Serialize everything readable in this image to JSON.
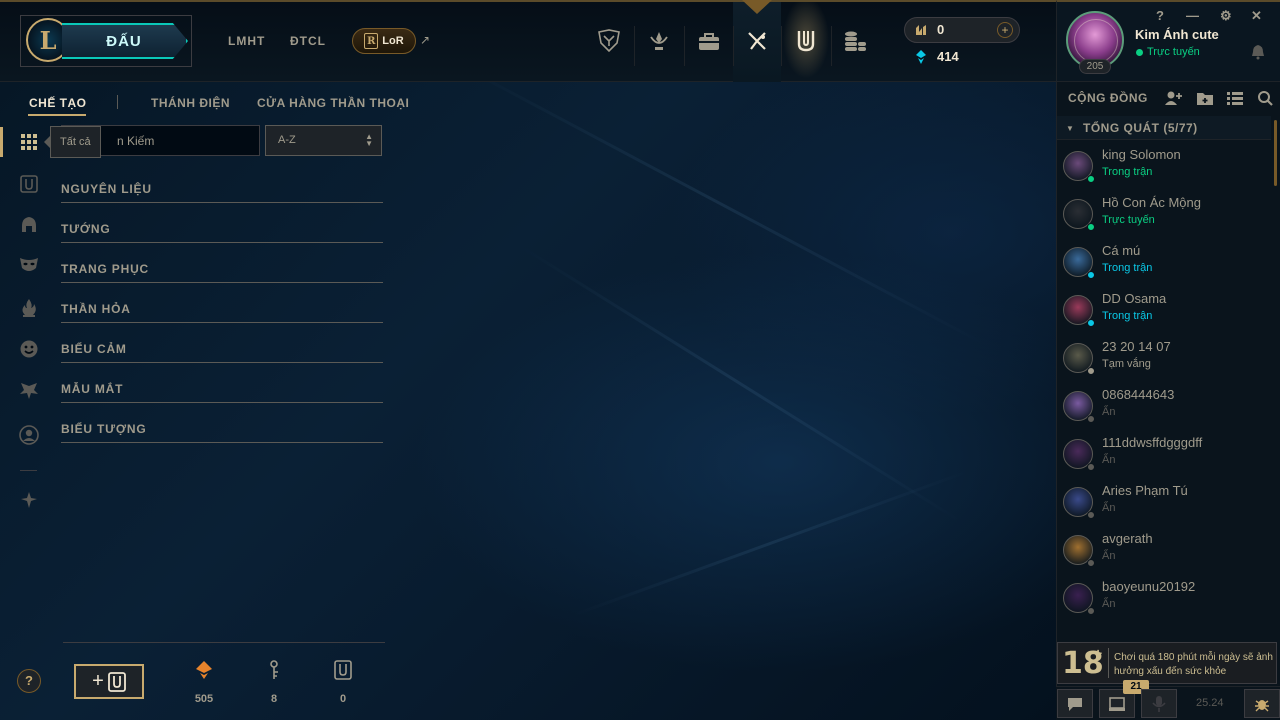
{
  "topbar": {
    "logo_letter": "L",
    "play_label": "ĐẤU",
    "nav_links": [
      "LMHT",
      "ĐTCL"
    ],
    "lor_label": "LoR",
    "lor_badge_letter": "R",
    "external_arrow": "↗",
    "tools": [
      "esports-crest-icon",
      "rank-crest-icon",
      "inventory-bag-icon",
      "loot-hextech-icon",
      "collection-icon",
      "store-coins-icon"
    ],
    "rp_value": "0",
    "be_value": "414",
    "plus_label": "+"
  },
  "profile": {
    "name": "Kim Ánh cute",
    "status": "Trực tuyến",
    "level": "205",
    "controls": [
      "?",
      "—",
      "⚙",
      "✕"
    ]
  },
  "subnav": {
    "tabs": [
      "CHẾ TẠO",
      "THÁNH ĐIỆN",
      "CỬA HÀNG THẦN THOẠI"
    ]
  },
  "loot": {
    "tooltip": "Tất cả",
    "search_placeholder": "Tìm Kiếm",
    "search_visible_text": "n Kiếm",
    "sort_value": "A-Z",
    "categories": [
      "NGUYÊN LIỆU",
      "TƯỚNG",
      "TRANG PHỤC",
      "THẦN HỎA",
      "BIỂU CẢM",
      "MẪU MẮT",
      "BIỂU TƯỢNG"
    ],
    "add_chest_label": "+",
    "help_label": "?",
    "stats": {
      "orange_essence": "505",
      "keys": "8",
      "chests": "0"
    }
  },
  "social": {
    "title": "CỘNG ĐỒNG",
    "group_label": "TỔNG QUÁT (5/77)",
    "friends": [
      {
        "name": "king Solomon",
        "status": "Trong trận",
        "status_color": "#0acf83"
      },
      {
        "name": "Hồ Con Ác Mộng",
        "status": "Trực tuyến",
        "status_color": "#0acf83"
      },
      {
        "name": "Cá mú",
        "status": "Trong trận",
        "status_color": "#0ac8e6"
      },
      {
        "name": "DD Osama",
        "status": "Trong trận",
        "status_color": "#0ac8e6"
      },
      {
        "name": "23 20 14 07",
        "status": "Tạm vắng",
        "status_color": "#a09b8c"
      },
      {
        "name": "0868444643",
        "status": "Ẩn",
        "status_color": "#5b5a56"
      },
      {
        "name": "111ddwsffdgggdff",
        "status": "Ẩn",
        "status_color": "#5b5a56"
      },
      {
        "name": "Aries Phạm Tú",
        "status": "Ẩn",
        "status_color": "#5b5a56"
      },
      {
        "name": "avgerath",
        "status": "Ẩn",
        "status_color": "#5b5a56"
      },
      {
        "name": "baoyeunu20192",
        "status": "Ẩn",
        "status_color": "#5b5a56"
      }
    ],
    "age_rating": "18",
    "age_plus": "+",
    "age_warning": "Chơi quá 180 phút mỗi ngày sẽ ảnh hưởng xấu đến sức khỏe",
    "mission_badge": "21",
    "version": "25.24"
  },
  "colors": {
    "gold": "#c8aa6e",
    "teal": "#0ac8b9",
    "online": "#0acf83",
    "ingame": "#0ac8e6",
    "background": "#010a13"
  }
}
